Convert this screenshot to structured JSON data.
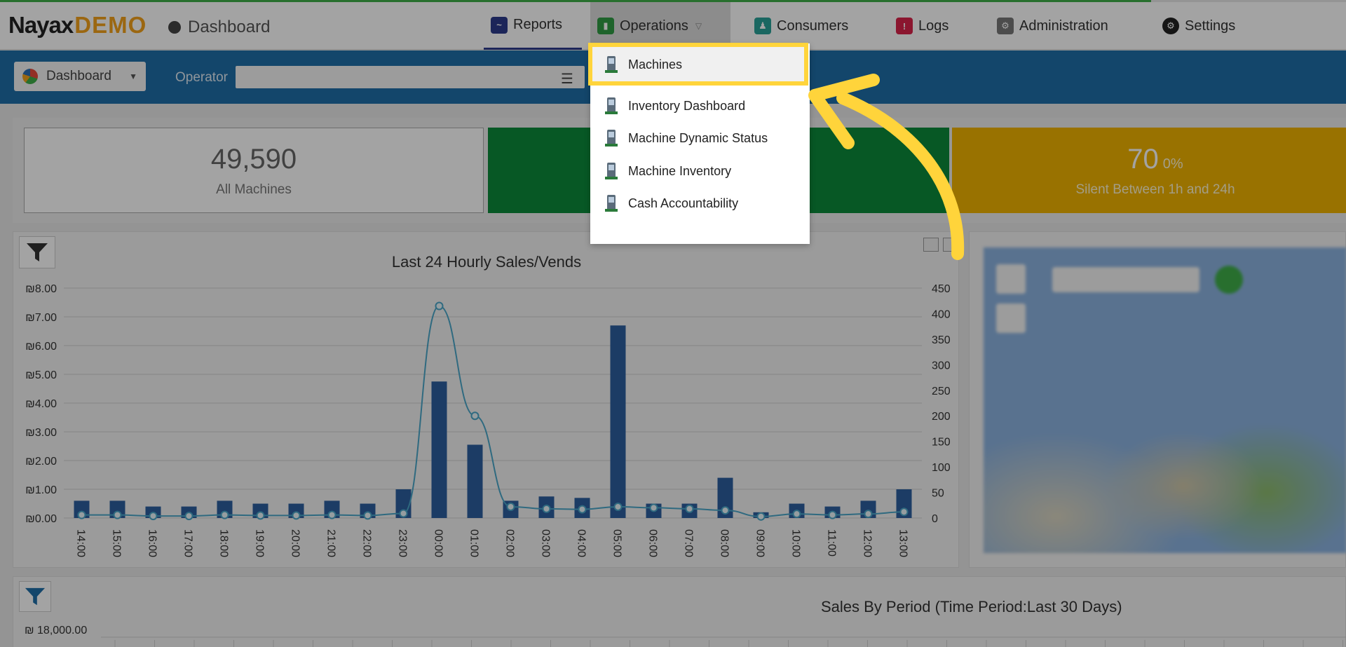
{
  "brand": {
    "logo_main": "Nayax",
    "logo_demo": "DEMO",
    "page": "Dashboard"
  },
  "nav": {
    "reports": "Reports",
    "operations": "Operations",
    "consumers": "Consumers",
    "logs": "Logs",
    "administration": "Administration",
    "settings": "Settings"
  },
  "toolbar": {
    "dashboard_select": "Dashboard",
    "operator_label": "Operator",
    "operator_value": ""
  },
  "operations_menu": [
    {
      "label": "Machines",
      "icon": "machines-icon",
      "highlighted": true
    },
    {
      "label": "Inventory Dashboard",
      "icon": "inventory-dashboard-icon"
    },
    {
      "label": "Machine Dynamic Status",
      "icon": "machine-dynamic-status-icon"
    },
    {
      "label": "Machine Inventory",
      "icon": "machine-inventory-icon"
    },
    {
      "label": "Cash Accountability",
      "icon": "cash-accountability-icon"
    }
  ],
  "kpis": {
    "all_machines": {
      "value": "49,590",
      "label": "All Machines"
    },
    "silent": {
      "value": "70",
      "pct": "0%",
      "label": "Silent Between 1h and 24h"
    }
  },
  "chart_data": {
    "type": "bar",
    "title": "Last 24 Hourly Sales/Vends",
    "categories": [
      "14:00",
      "15:00",
      "16:00",
      "17:00",
      "18:00",
      "19:00",
      "20:00",
      "21:00",
      "22:00",
      "23:00",
      "00:00",
      "01:00",
      "02:00",
      "03:00",
      "04:00",
      "05:00",
      "06:00",
      "07:00",
      "08:00",
      "09:00",
      "10:00",
      "11:00",
      "12:00",
      "13:00"
    ],
    "y_ticks": [
      "₪0.00",
      "₪1.00",
      "₪2.00",
      "₪3.00",
      "₪4.00",
      "₪5.00",
      "₪6.00",
      "₪7.00",
      "₪8.00"
    ],
    "y2_ticks": [
      "0",
      "50",
      "100",
      "150",
      "200",
      "250",
      "300",
      "350",
      "400",
      "450"
    ],
    "ylim": [
      0,
      8
    ],
    "y2lim": [
      0,
      450
    ],
    "series": [
      {
        "type": "bar",
        "axis": "left",
        "values": [
          0.6,
          0.6,
          0.4,
          0.4,
          0.6,
          0.5,
          0.5,
          0.6,
          0.5,
          1.0,
          4.75,
          2.55,
          0.6,
          0.75,
          0.7,
          6.7,
          0.5,
          0.5,
          1.4,
          0.2,
          0.5,
          0.4,
          0.6,
          1.0
        ]
      },
      {
        "type": "line",
        "axis": "right",
        "values": [
          6,
          6,
          4,
          4,
          6,
          5,
          5,
          6,
          5,
          9,
          415,
          200,
          22,
          18,
          17,
          22,
          20,
          18,
          15,
          3,
          8,
          6,
          8,
          12
        ]
      }
    ],
    "colors": {
      "bar": "#2c5f9e",
      "line": "#4aa6c8"
    }
  },
  "period_chart": {
    "title": "Sales By Period (Time Period:Last 30 Days)",
    "y_tick_top": "₪ 18,000.00"
  },
  "colors": {
    "highlight": "#ffd43b",
    "arrow": "#ffd43b",
    "toolbar": "#1f6ea8"
  }
}
